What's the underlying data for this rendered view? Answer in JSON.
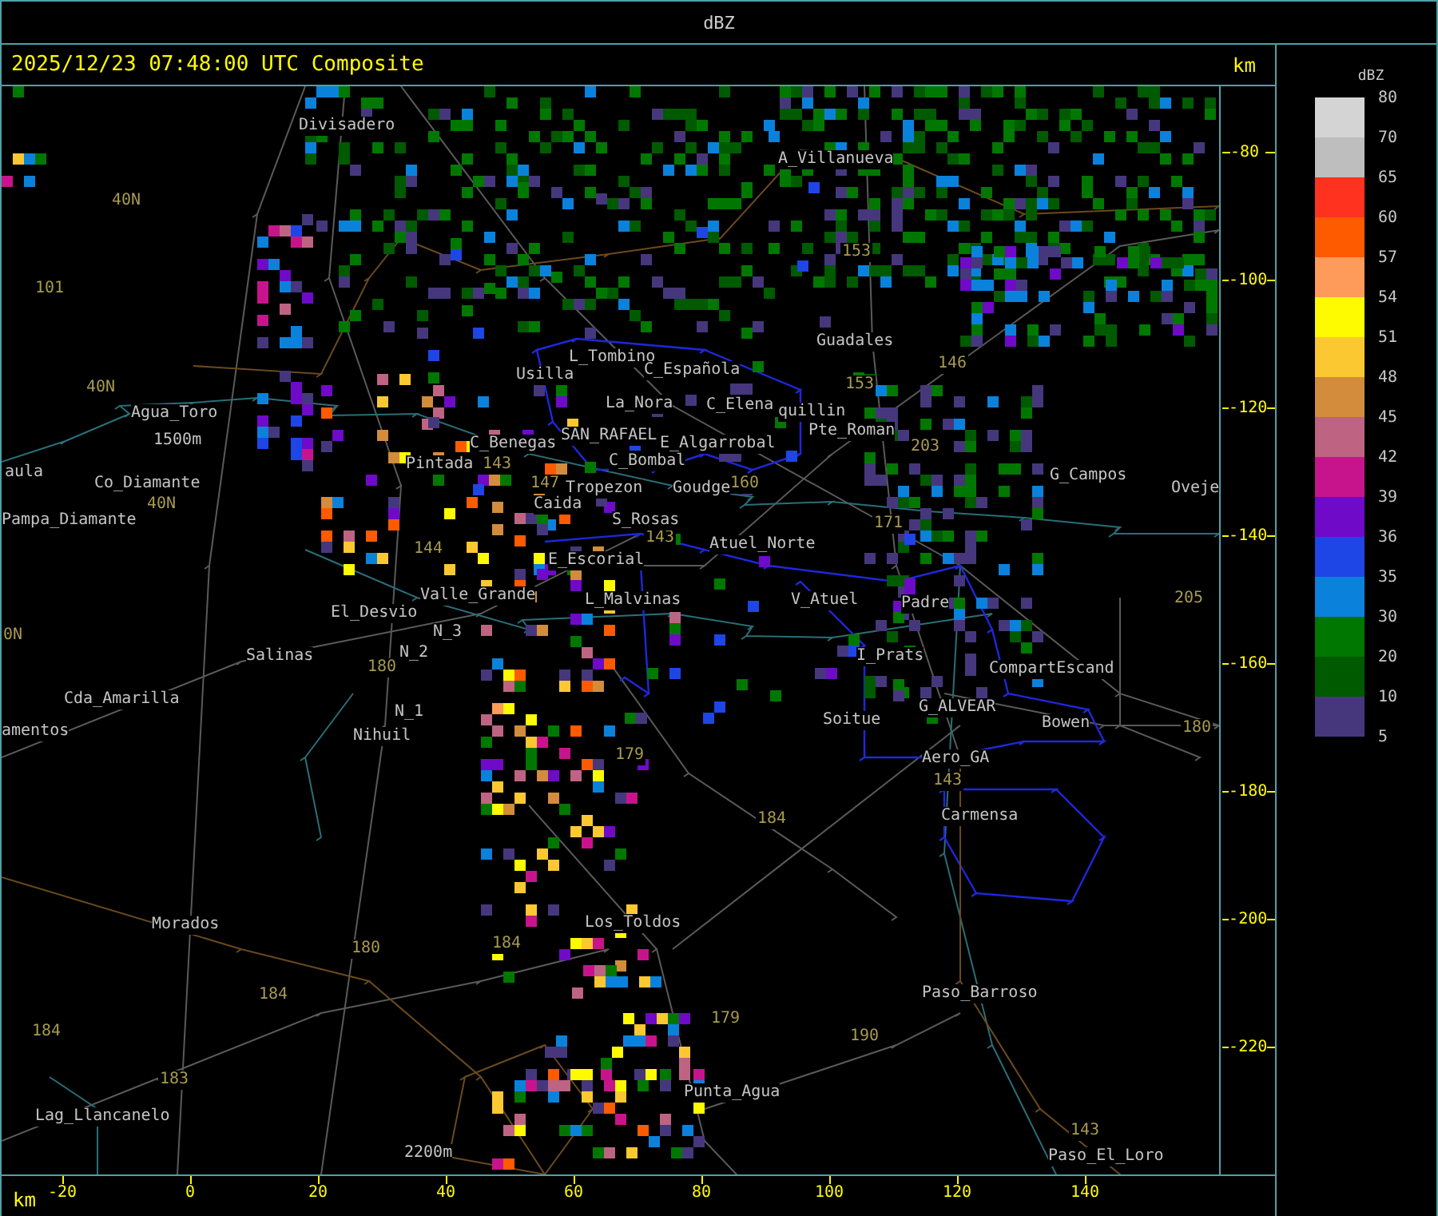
{
  "header": {
    "title": "dBZ"
  },
  "map": {
    "timestamp": "2025/12/23 07:48:00 UTC Composite",
    "unit": "km",
    "places": [
      {
        "name": "Divisadero"
      },
      {
        "name": "A_Villanueva"
      },
      {
        "name": "Guadales"
      },
      {
        "name": "L_Tombino"
      },
      {
        "name": "Usilla"
      },
      {
        "name": "C_Española"
      },
      {
        "name": "La_Nora"
      },
      {
        "name": "C_Elena"
      },
      {
        "name": "quillin"
      },
      {
        "name": "Pte_Roman"
      },
      {
        "name": "Agua_Toro"
      },
      {
        "name": "1500m"
      },
      {
        "name": "Co_Diamante"
      },
      {
        "name": "aula"
      },
      {
        "name": "Pampa_Diamante"
      },
      {
        "name": "Pintada"
      },
      {
        "name": "C_Benegas"
      },
      {
        "name": "SAN_RAFAEL"
      },
      {
        "name": "E_Algarrobal"
      },
      {
        "name": "C_Bombal"
      },
      {
        "name": "G_Campos"
      },
      {
        "name": "Tropezon"
      },
      {
        "name": "Goudge"
      },
      {
        "name": "Oveje"
      },
      {
        "name": "Caida"
      },
      {
        "name": "S_Rosas"
      },
      {
        "name": "Atuel_Norte"
      },
      {
        "name": "E_Escorial"
      },
      {
        "name": "Valle_Grande"
      },
      {
        "name": "L_Malvinas"
      },
      {
        "name": "V_Atuel"
      },
      {
        "name": "Padre"
      },
      {
        "name": "El_Desvio"
      },
      {
        "name": "Salinas"
      },
      {
        "name": "N_3"
      },
      {
        "name": "N_2"
      },
      {
        "name": "N_1"
      },
      {
        "name": "Nihuil"
      },
      {
        "name": "Cda_Amarilla"
      },
      {
        "name": "amentos"
      },
      {
        "name": "I_Prats"
      },
      {
        "name": "CompartEscand"
      },
      {
        "name": "G_ALVEAR"
      },
      {
        "name": "Soitue"
      },
      {
        "name": "Bowen"
      },
      {
        "name": "Aero_GA"
      },
      {
        "name": "Carmensa"
      },
      {
        "name": "Morados"
      },
      {
        "name": "Los_Toldos"
      },
      {
        "name": "Paso_Barroso"
      },
      {
        "name": "Punta_Agua"
      },
      {
        "name": "Lag_Llancanelo"
      },
      {
        "name": "2200m"
      },
      {
        "name": "Paso_El_Loro"
      }
    ],
    "route_labels": [
      {
        "text": "40N"
      },
      {
        "text": "101"
      },
      {
        "text": "40N"
      },
      {
        "text": "40N"
      },
      {
        "text": "0N"
      },
      {
        "text": "153"
      },
      {
        "text": "153"
      },
      {
        "text": "146"
      },
      {
        "text": "203"
      },
      {
        "text": "171"
      },
      {
        "text": "144"
      },
      {
        "text": "143"
      },
      {
        "text": "147"
      },
      {
        "text": "160"
      },
      {
        "text": "143"
      },
      {
        "text": "180"
      },
      {
        "text": "179"
      },
      {
        "text": "184"
      },
      {
        "text": "143"
      },
      {
        "text": "205"
      },
      {
        "text": "180"
      },
      {
        "text": "184"
      },
      {
        "text": "180"
      },
      {
        "text": "184"
      },
      {
        "text": "184"
      },
      {
        "text": "183"
      },
      {
        "text": "179"
      },
      {
        "text": "190"
      },
      {
        "text": "143"
      }
    ],
    "y_axis": [
      "-80",
      "-100",
      "-120",
      "-140",
      "-160",
      "-180",
      "-200",
      "-220"
    ],
    "x_axis": {
      "unit": "km",
      "ticks": [
        "-20",
        "0",
        "20",
        "40",
        "60",
        "80",
        "100",
        "120",
        "140"
      ]
    }
  },
  "legend": {
    "title": "dBZ",
    "items": [
      {
        "label": "80",
        "color": "#d4d4d4"
      },
      {
        "label": "70",
        "color": "#bebebe"
      },
      {
        "label": "65",
        "color": "#fe321e"
      },
      {
        "label": "60",
        "color": "#fe5a00"
      },
      {
        "label": "57",
        "color": "#fe9a5a"
      },
      {
        "label": "54",
        "color": "#fefa00"
      },
      {
        "label": "51",
        "color": "#fcc832"
      },
      {
        "label": "48",
        "color": "#d28c3c"
      },
      {
        "label": "45",
        "color": "#be6482"
      },
      {
        "label": "42",
        "color": "#c8148c"
      },
      {
        "label": "39",
        "color": "#6e0ac8"
      },
      {
        "label": "36",
        "color": "#1e46e6"
      },
      {
        "label": "35",
        "color": "#0a82dc"
      },
      {
        "label": "30",
        "color": "#007800"
      },
      {
        "label": "20",
        "color": "#005a00"
      },
      {
        "label": "10",
        "color": "#46377d"
      },
      {
        "label": "5"
      }
    ]
  }
}
